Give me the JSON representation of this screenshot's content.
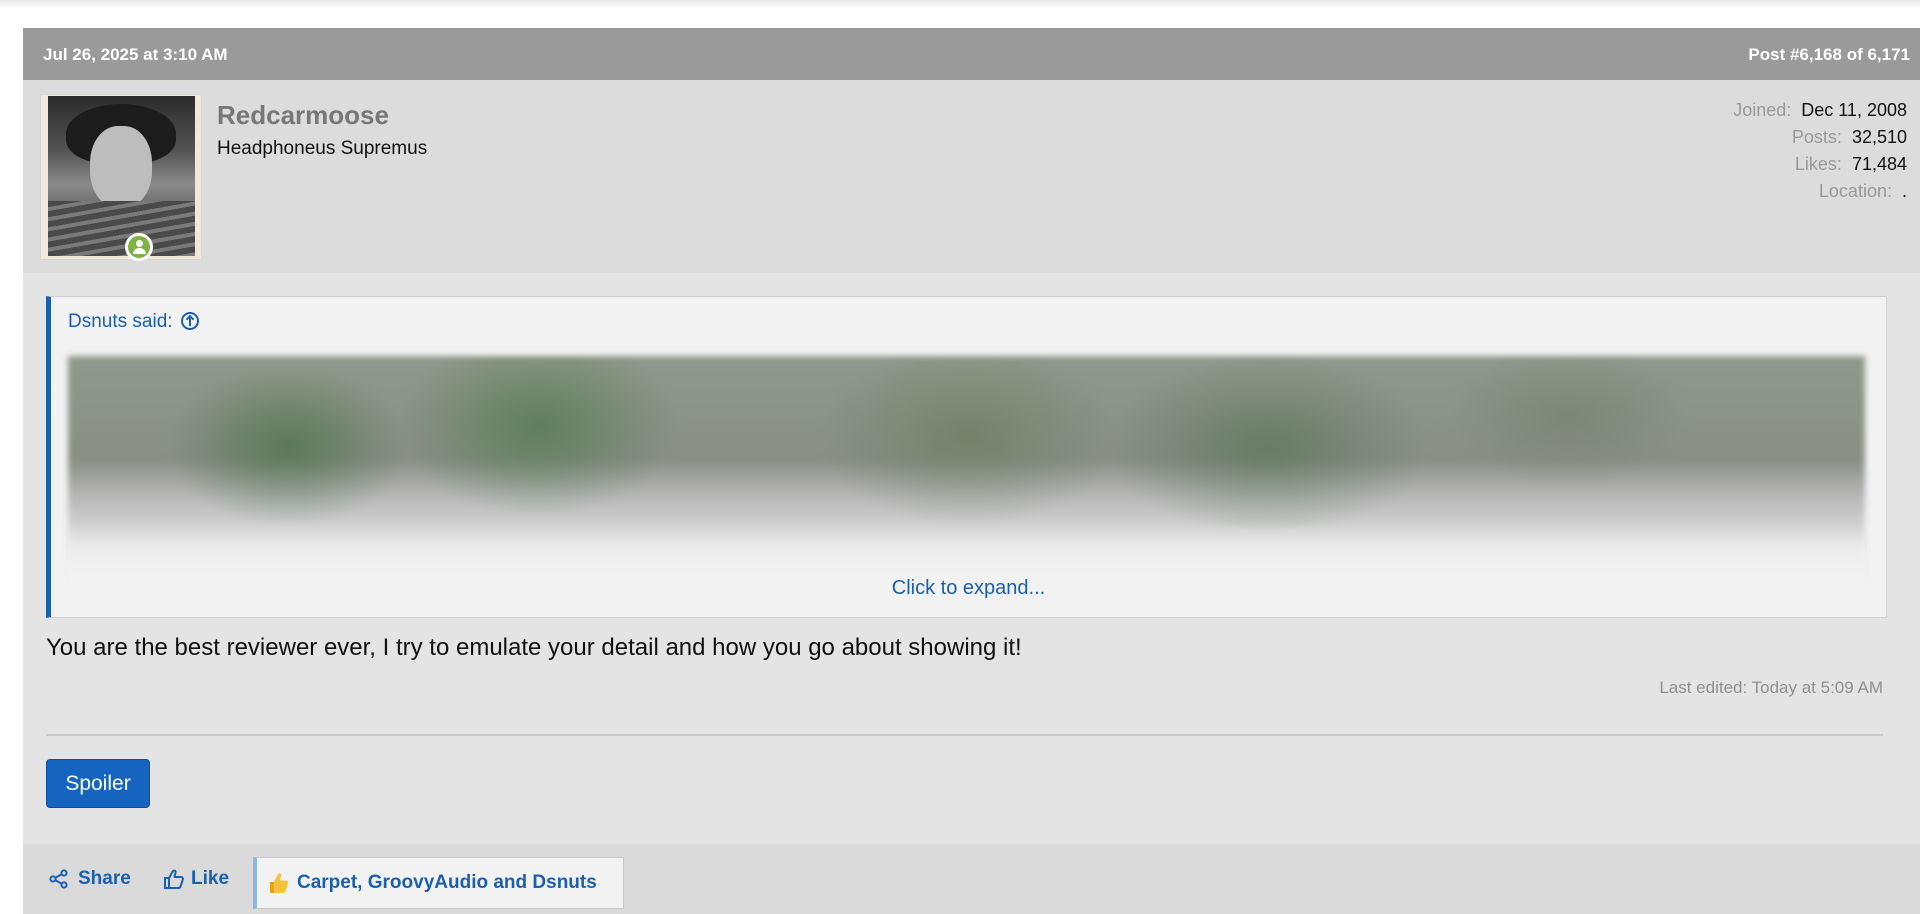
{
  "post": {
    "date": "Jul 26, 2025 at 3:10 AM",
    "number": "Post #6,168 of 6,171"
  },
  "user": {
    "name": "Redcarmoose",
    "title": "Headphoneus Supremus",
    "stats": [
      {
        "label": "Joined:",
        "value": "Dec 11, 2008"
      },
      {
        "label": "Posts:",
        "value": "32,510"
      },
      {
        "label": "Likes:",
        "value": "71,484"
      },
      {
        "label": "Location:",
        "value": "."
      }
    ]
  },
  "quote": {
    "author": "Dsnuts said:",
    "expand_label": "Click to expand..."
  },
  "message": {
    "text": "You are the best reviewer ever, I try to emulate your detail and how you go about showing it!",
    "last_edited": "Last edited: Today at 5:09 AM"
  },
  "spoiler": {
    "label": "Spoiler"
  },
  "actions": {
    "share": "Share",
    "like": "Like",
    "reactions": "Carpet, GroovyAudio and Dsnuts"
  },
  "colors": {
    "accent": "#1b5fb0",
    "button": "#1565c0",
    "header": "#9a9a9a",
    "online": "#7cb342"
  }
}
